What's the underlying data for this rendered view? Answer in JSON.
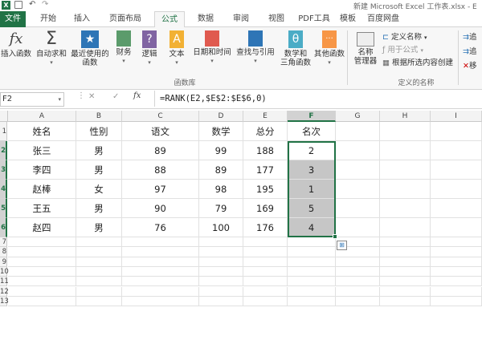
{
  "window": {
    "title": "新建 Microsoft Excel 工作表.xlsx - E"
  },
  "tabs": [
    {
      "label": "文件",
      "active": false,
      "file": true
    },
    {
      "label": "开始"
    },
    {
      "label": "插入"
    },
    {
      "label": "页面布局"
    },
    {
      "label": "公式",
      "active": true
    },
    {
      "label": "数据"
    },
    {
      "label": "审阅"
    },
    {
      "label": "视图"
    },
    {
      "label": "PDF工具"
    },
    {
      "label": "模板"
    },
    {
      "label": "百度网盘"
    }
  ],
  "ribbon": {
    "buttons": [
      {
        "label": "插入函数",
        "icon": "fx-icon"
      },
      {
        "label": "自动求和",
        "icon": "sigma-icon"
      },
      {
        "label": "最近使用的\n函数",
        "icon": "star-icon"
      },
      {
        "label": "财务",
        "icon": "finance-icon"
      },
      {
        "label": "逻辑",
        "icon": "question-icon"
      },
      {
        "label": "文本",
        "icon": "text-icon"
      },
      {
        "label": "日期和时间",
        "icon": "calendar-icon"
      },
      {
        "label": "查找与引用",
        "icon": "lookup-icon"
      },
      {
        "label": "数学和\n三角函数",
        "icon": "theta-icon"
      },
      {
        "label": "其他函数",
        "icon": "more-icon"
      }
    ],
    "group_function_library": "函数库",
    "name_manager": "名称\n管理器",
    "define_name": "定义名称",
    "use_in_formula": "用于公式",
    "create_from_selection": "根据所选内容创建",
    "group_defined_names": "定义的名称",
    "right_edge": [
      "追",
      "追",
      "移"
    ]
  },
  "formula_bar": {
    "name_box": "F2",
    "fx": "fx",
    "formula": "=RANK(E2,$E$2:$E$6,0)"
  },
  "columns": [
    "A",
    "B",
    "C",
    "D",
    "E",
    "F",
    "G",
    "H",
    "I"
  ],
  "rows": [
    "1",
    "2",
    "3",
    "4",
    "5",
    "6",
    "7",
    "8",
    "9",
    "10",
    "11",
    "12",
    "13"
  ],
  "sheet": {
    "header": [
      "姓名",
      "性别",
      "语文",
      "数学",
      "总分",
      "名次"
    ],
    "data": [
      [
        "张三",
        "男",
        "89",
        "99",
        "188",
        "2"
      ],
      [
        "李四",
        "男",
        "88",
        "89",
        "177",
        "3"
      ],
      [
        "赵棒",
        "女",
        "97",
        "98",
        "195",
        "1"
      ],
      [
        "王五",
        "男",
        "90",
        "79",
        "169",
        "5"
      ],
      [
        "赵四",
        "男",
        "76",
        "100",
        "176",
        "4"
      ]
    ]
  },
  "colors": {
    "excel_green": "#217346",
    "selection_fill": "#c6c6c6",
    "selection_border": "#217346"
  }
}
